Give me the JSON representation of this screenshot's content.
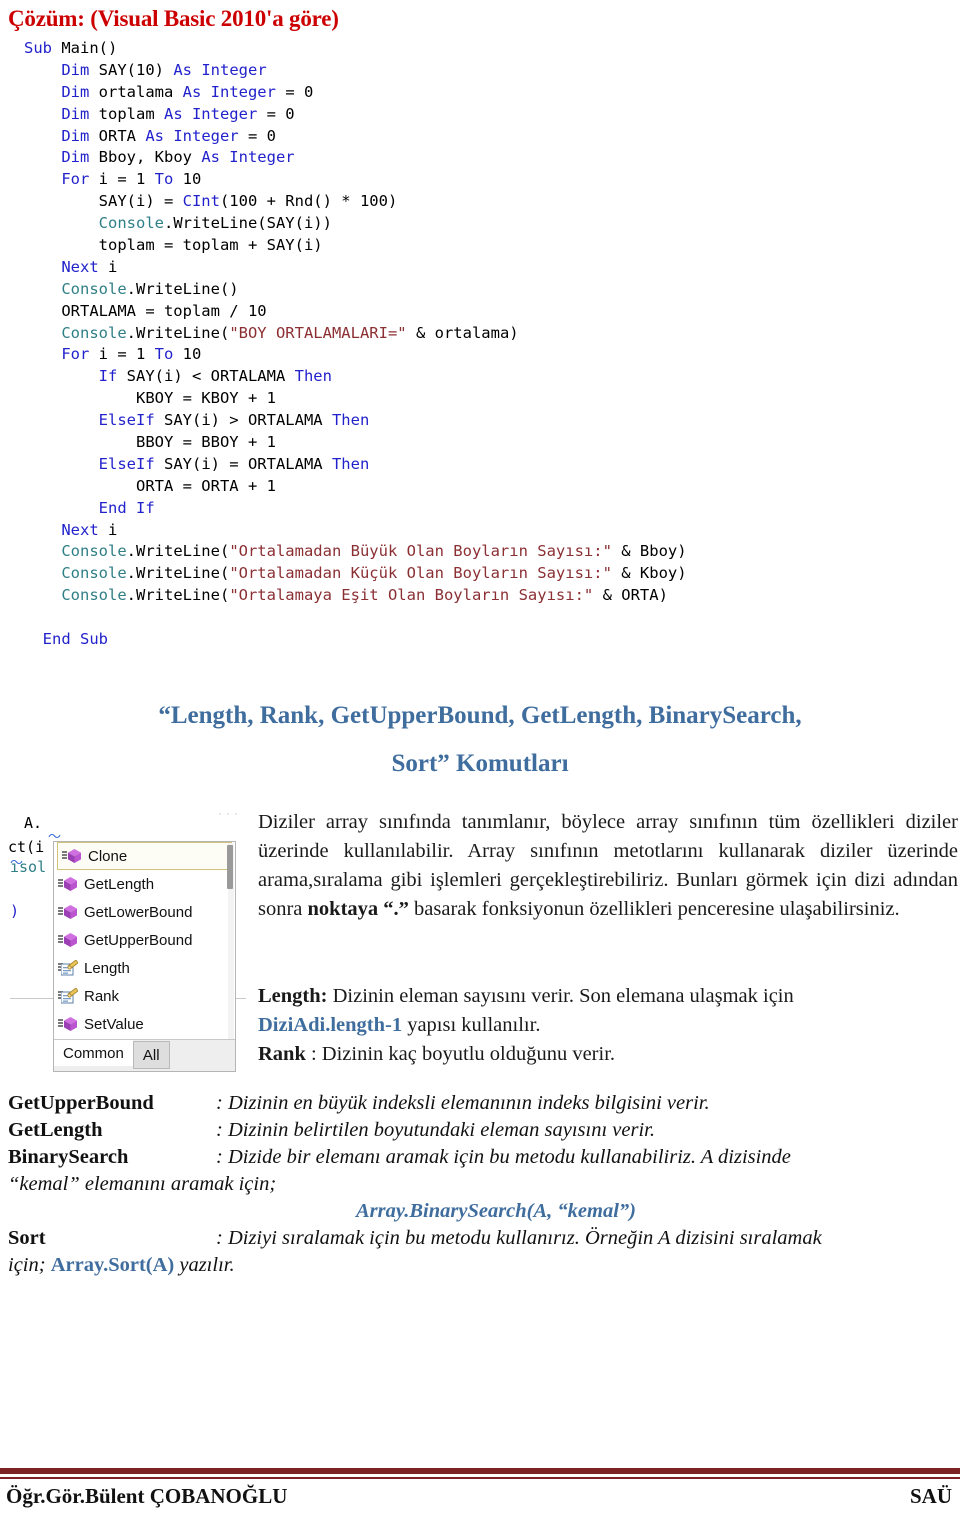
{
  "doc": {
    "title": "Çözüm: (Visual Basic 2010'a göre)"
  },
  "code": {
    "lines": [
      [
        {
          "t": "Sub Main()",
          "c": "kw-part"
        }
      ],
      [
        {
          "t": "    "
        },
        {
          "t": "Dim",
          "c": "kw"
        },
        {
          "t": " SAY(10) "
        },
        {
          "t": "As Integer",
          "c": "kw"
        }
      ],
      [
        {
          "t": "    "
        },
        {
          "t": "Dim",
          "c": "kw"
        },
        {
          "t": " ortalama "
        },
        {
          "t": "As Integer",
          "c": "kw"
        },
        {
          "t": " = 0"
        }
      ],
      [
        {
          "t": "    "
        },
        {
          "t": "Dim",
          "c": "kw"
        },
        {
          "t": " toplam "
        },
        {
          "t": "As Integer",
          "c": "kw"
        },
        {
          "t": " = 0"
        }
      ],
      [
        {
          "t": "    "
        },
        {
          "t": "Dim",
          "c": "kw"
        },
        {
          "t": " ORTA "
        },
        {
          "t": "As Integer",
          "c": "kw"
        },
        {
          "t": " = 0"
        }
      ],
      [
        {
          "t": "    "
        },
        {
          "t": "Dim",
          "c": "kw"
        },
        {
          "t": " Bboy, Kboy "
        },
        {
          "t": "As Integer",
          "c": "kw"
        }
      ],
      [
        {
          "t": "    "
        },
        {
          "t": "For",
          "c": "kw"
        },
        {
          "t": " i = 1 "
        },
        {
          "t": "To",
          "c": "kw"
        },
        {
          "t": " 10"
        }
      ],
      [
        {
          "t": "        SAY(i) = "
        },
        {
          "t": "CInt",
          "c": "kw"
        },
        {
          "t": "(100 + Rnd() * 100)"
        }
      ],
      [
        {
          "t": "        "
        },
        {
          "t": "Console",
          "c": "cls"
        },
        {
          "t": ".WriteLine(SAY(i))"
        }
      ],
      [
        {
          "t": "        toplam = toplam + SAY(i)"
        }
      ],
      [
        {
          "t": "    "
        },
        {
          "t": "Next",
          "c": "kw"
        },
        {
          "t": " i"
        }
      ],
      [
        {
          "t": "    "
        },
        {
          "t": "Console",
          "c": "cls"
        },
        {
          "t": ".WriteLine()"
        }
      ],
      [
        {
          "t": "    ORTALAMA = toplam / 10"
        }
      ],
      [
        {
          "t": "    "
        },
        {
          "t": "Console",
          "c": "cls"
        },
        {
          "t": ".WriteLine("
        },
        {
          "t": "\"BOY ORTALAMALARI=\"",
          "c": "str"
        },
        {
          "t": " & ortalama)"
        }
      ],
      [
        {
          "t": "    "
        },
        {
          "t": "For",
          "c": "kw"
        },
        {
          "t": " i = 1 "
        },
        {
          "t": "To",
          "c": "kw"
        },
        {
          "t": " 10"
        }
      ],
      [
        {
          "t": "        "
        },
        {
          "t": "If",
          "c": "kw"
        },
        {
          "t": " SAY(i) < ORTALAMA "
        },
        {
          "t": "Then",
          "c": "kw"
        }
      ],
      [
        {
          "t": "            KBOY = KBOY + 1"
        }
      ],
      [
        {
          "t": "        "
        },
        {
          "t": "ElseIf",
          "c": "kw"
        },
        {
          "t": " SAY(i) > ORTALAMA "
        },
        {
          "t": "Then",
          "c": "kw"
        }
      ],
      [
        {
          "t": "            BBOY = BBOY + 1"
        }
      ],
      [
        {
          "t": "        "
        },
        {
          "t": "ElseIf",
          "c": "kw"
        },
        {
          "t": " SAY(i) = ORTALAMA "
        },
        {
          "t": "Then",
          "c": "kw"
        }
      ],
      [
        {
          "t": "            ORTA = ORTA + 1"
        }
      ],
      [
        {
          "t": "        "
        },
        {
          "t": "End If",
          "c": "kw"
        }
      ],
      [
        {
          "t": "    "
        },
        {
          "t": "Next",
          "c": "kw"
        },
        {
          "t": " i"
        }
      ],
      [
        {
          "t": "    "
        },
        {
          "t": "Console",
          "c": "cls"
        },
        {
          "t": ".WriteLine("
        },
        {
          "t": "\"Ortalamadan Büyük Olan Boyların Sayısı:\"",
          "c": "str"
        },
        {
          "t": " & Bboy)"
        }
      ],
      [
        {
          "t": "    "
        },
        {
          "t": "Console",
          "c": "cls"
        },
        {
          "t": ".WriteLine("
        },
        {
          "t": "\"Ortalamadan Küçük Olan Boyların Sayısı:\"",
          "c": "str"
        },
        {
          "t": " & Kboy)"
        }
      ],
      [
        {
          "t": "    "
        },
        {
          "t": "Console",
          "c": "cls"
        },
        {
          "t": ".WriteLine("
        },
        {
          "t": "\"Ortalamaya Eşit Olan Boyların Sayısı:\"",
          "c": "str"
        },
        {
          "t": " & ORTA)"
        }
      ],
      [
        {
          "t": ""
        }
      ],
      [
        {
          "t": "  "
        },
        {
          "t": "End Sub",
          "c": "kw"
        }
      ]
    ]
  },
  "blue_heading": {
    "line1": "“Length, Rank, GetUpperBound, GetLength, BinarySearch,",
    "line2": "Sort” Komutları",
    "color": "#3F6D9E"
  },
  "vs_screenshot": {
    "bg_code": {
      "frag1": "A.",
      "frag2": "ct(i",
      "frag3": "ısol",
      "frag4": ")"
    },
    "popup": {
      "items": [
        {
          "label": "Clone",
          "icon": "method-cube-icon",
          "selected": true
        },
        {
          "label": "GetLength",
          "icon": "method-cube-icon",
          "selected": false
        },
        {
          "label": "GetLowerBound",
          "icon": "method-cube-icon",
          "selected": false
        },
        {
          "label": "GetUpperBound",
          "icon": "method-cube-icon",
          "selected": false
        },
        {
          "label": "Length",
          "icon": "property-icon",
          "selected": false
        },
        {
          "label": "Rank",
          "icon": "property-icon",
          "selected": false
        },
        {
          "label": "SetValue",
          "icon": "method-cube-icon",
          "selected": false
        }
      ],
      "tabs": [
        {
          "label": "Common",
          "active": true
        },
        {
          "label": "All",
          "active": false
        }
      ]
    }
  },
  "right_column": {
    "paragraph_pre": "Diziler array sınıfında tanımlanır, böylece array sınıfının tüm özellikleri diziler üzerinde kullanılabilir. Array sınıfının metotlarını kullanarak diziler üzerinde arama,sıralama gibi işlemleri gerçekleştirebiliriz. Bunları görmek için dizi adından sonra ",
    "paragraph_bold": "noktaya “.”",
    "paragraph_post": " basarak fonksiyonun özellikleri penceresine ulaşabilirsiniz.",
    "length_term": "Length:",
    "length_desc": " Dizinin eleman sayısını verir. Son elemana ulaşmak için",
    "length_code": "DiziAdi.length-1",
    "length_tail": " yapısı kullanılır.",
    "rank_term": "Rank",
    "rank_desc": "  : Dizinin kaç boyutlu olduğunu verir."
  },
  "definitions": {
    "rows": [
      {
        "term": "GetUpperBound",
        "desc": ": Dizinin en büyük indeksli elemanının indeks bilgisini verir."
      },
      {
        "term": "GetLength",
        "desc": ": Dizinin belirtilen boyutundaki eleman sayısını verir."
      },
      {
        "term": "BinarySearch",
        "desc": ": Dizide bir elemanı aramak için bu metodu kullanabiliriz.  A dizisinde"
      }
    ],
    "binarysearch_cont": "“kemal” elemanını aramak için;",
    "binarysearch_code": "Array.BinarySearch(A, “kemal”)",
    "sort_term": "Sort",
    "sort_desc": ": Diziyi sıralamak için bu metodu kullanırız. Örneğin A dizisini sıralamak",
    "sort_cont_pre": "için;   ",
    "sort_cont_code": "Array.Sort(A)",
    "sort_cont_post": " yazılır."
  },
  "footer": {
    "left": "Öğr.Gör.Bülent ÇOBANOĞLU",
    "right": "SAÜ",
    "rule_color": "#7B2423"
  }
}
